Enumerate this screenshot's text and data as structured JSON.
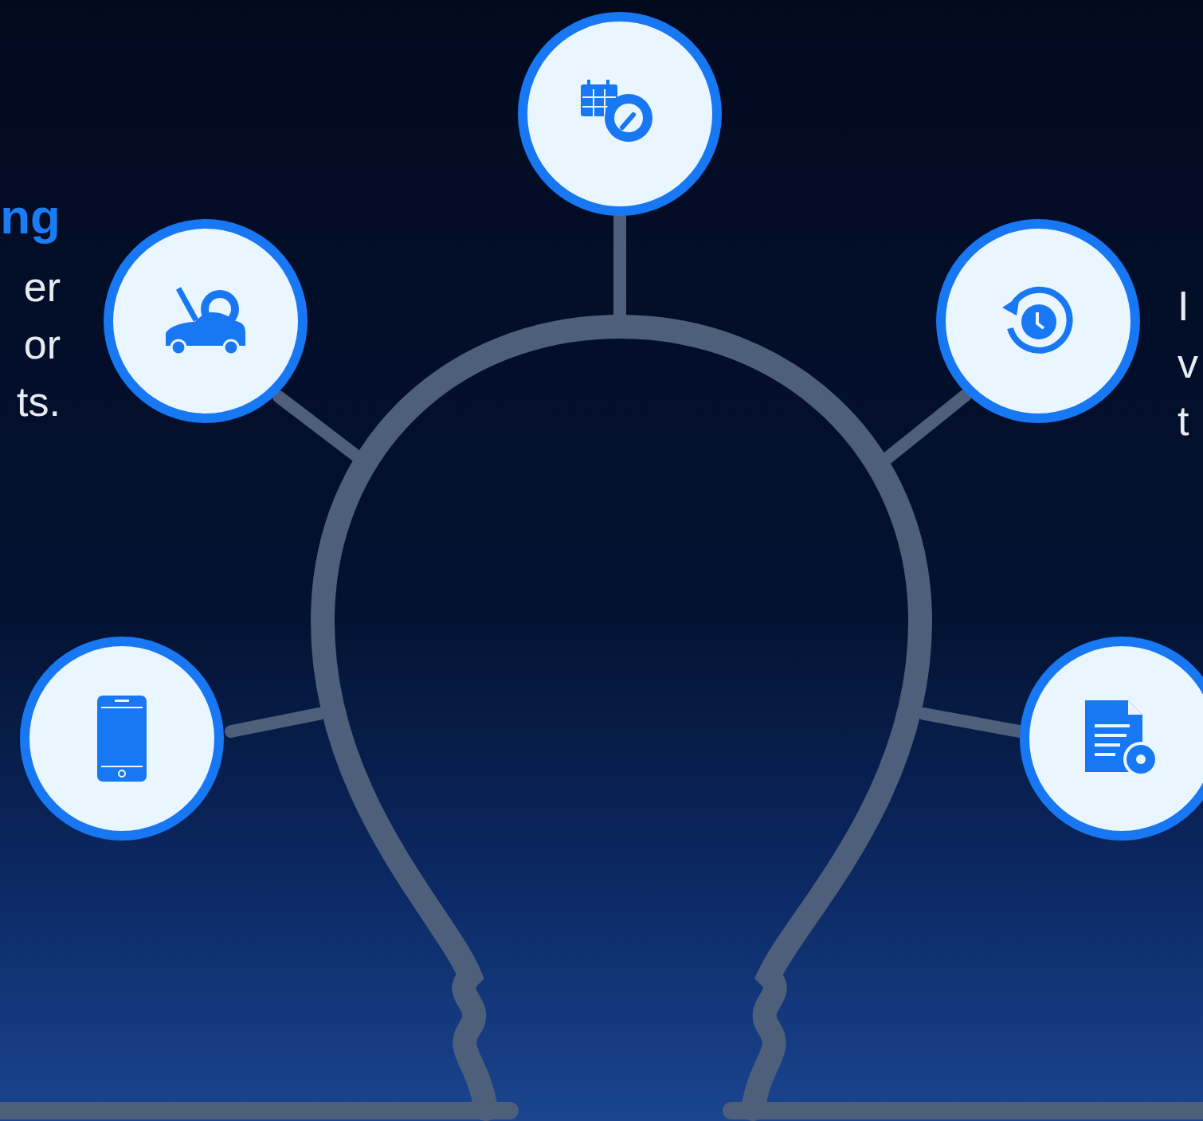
{
  "left_feature": {
    "heading": "ng",
    "lines": [
      "er",
      "or",
      "ts."
    ]
  },
  "right_feature": {
    "lines": [
      "I",
      "v",
      "t"
    ]
  }
}
